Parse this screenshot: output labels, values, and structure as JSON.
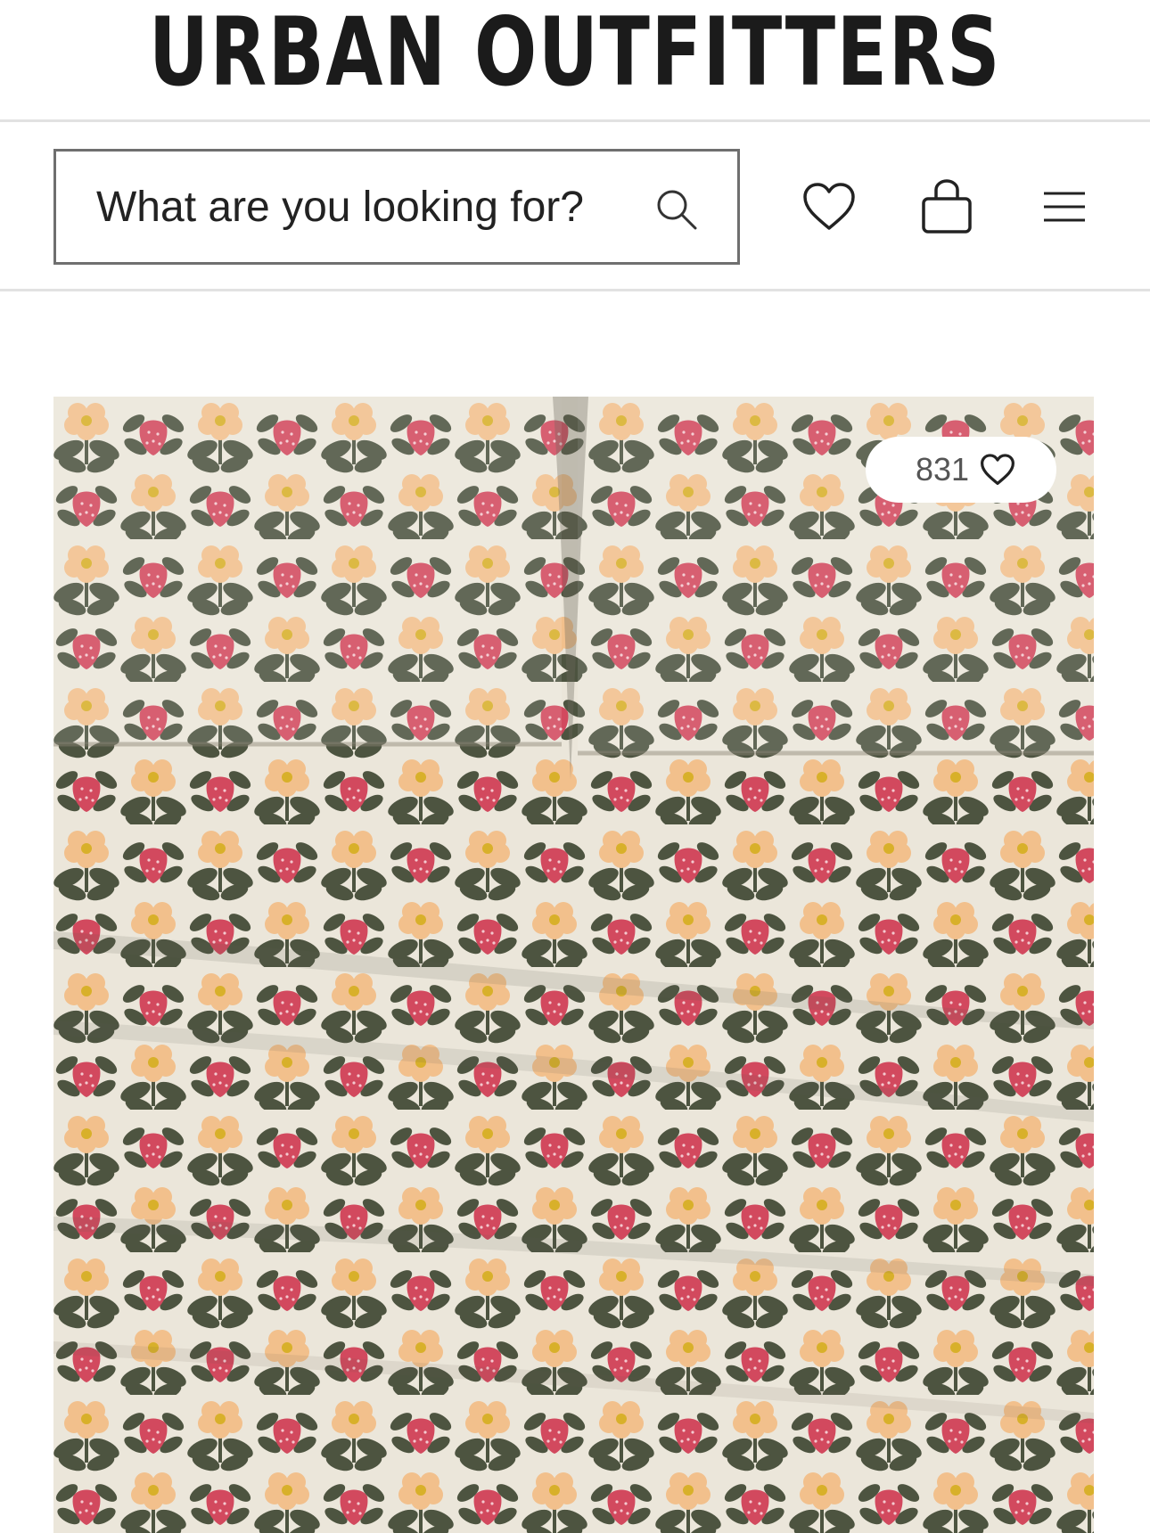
{
  "brand": {
    "logo_text": "URBAN OUTFITTERS"
  },
  "search": {
    "placeholder": "What are you looking for?"
  },
  "header_icons": [
    "heart-icon",
    "shopping-bag-icon",
    "hamburger-menu-icon"
  ],
  "product": {
    "like_count": "831",
    "image_pattern": {
      "background": "#ebe6da",
      "leaf": "#4d5440",
      "strawberry": "#d2495e",
      "flower": "#f2c08c",
      "flower_center": "#d8b02a"
    }
  }
}
